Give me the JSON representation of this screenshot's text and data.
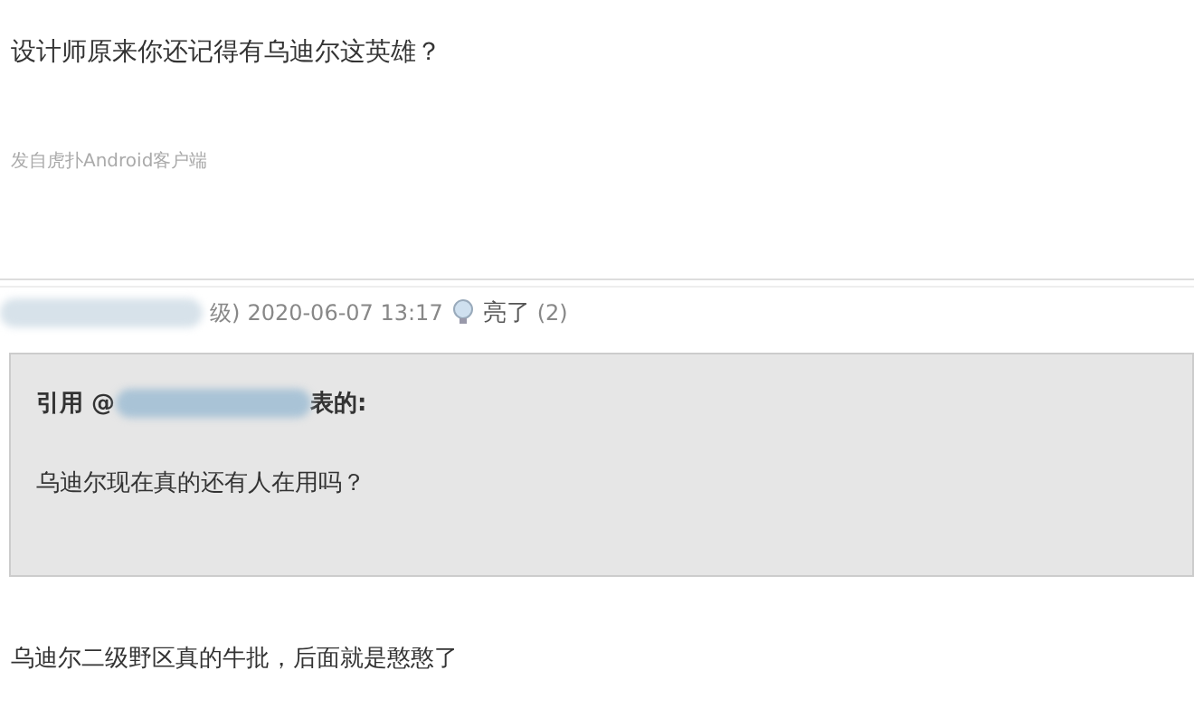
{
  "post": {
    "text": "设计师原来你还记得有乌迪尔这英雄？",
    "source": "发自虎扑Android客户端"
  },
  "reply": {
    "author_tail": "级)",
    "time": "2020-06-07 13:17",
    "light_label": "亮了",
    "light_count": "(2)",
    "quote": {
      "prefix": "引用 @",
      "suffix": "表的:",
      "text": "乌迪尔现在真的还有人在用吗？"
    },
    "text": "乌迪尔二级野区真的牛批，后面就是憨憨了"
  }
}
